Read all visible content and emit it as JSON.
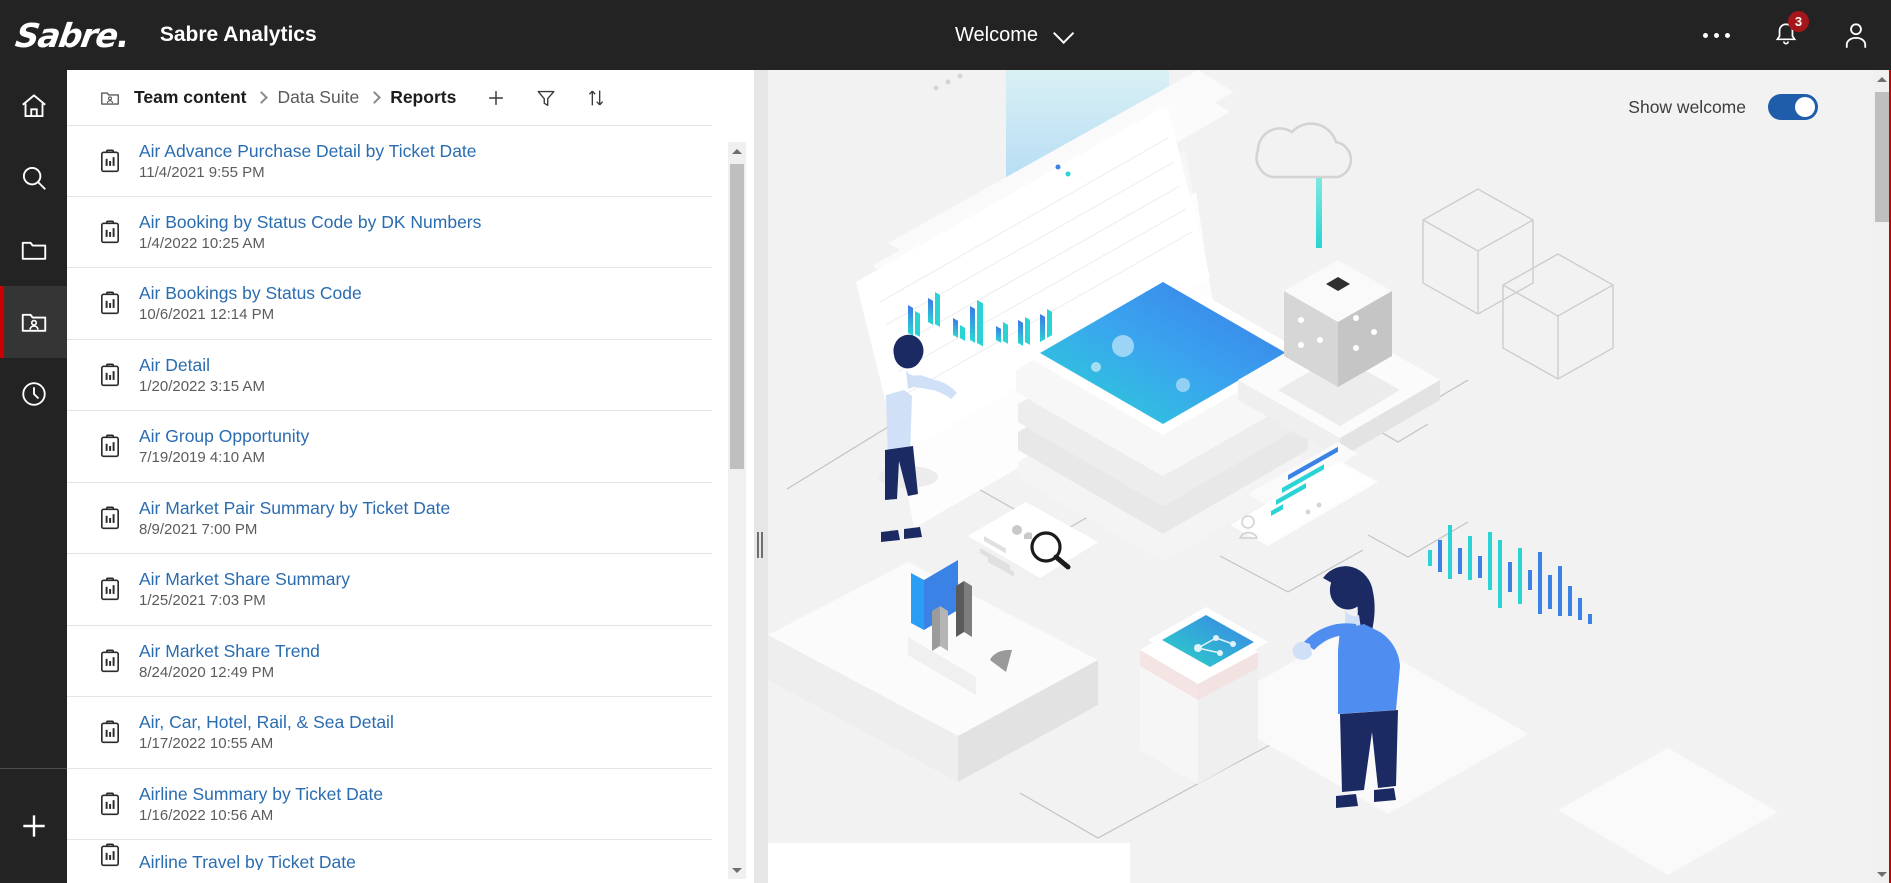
{
  "app": {
    "logo_text": "Sabre",
    "title": "Sabre Analytics",
    "welcome_menu_label": "Welcome"
  },
  "topbar": {
    "overflow_icon": "ellipsis-icon",
    "notifications_icon": "bell-icon",
    "notification_count": "3",
    "account_icon": "user-icon"
  },
  "sidebar": {
    "items": [
      {
        "name": "home",
        "icon": "home-icon",
        "active": false
      },
      {
        "name": "search",
        "icon": "search-icon",
        "active": false
      },
      {
        "name": "my-content",
        "icon": "folder-icon",
        "active": false
      },
      {
        "name": "team-content",
        "icon": "team-folder-icon",
        "active": true
      },
      {
        "name": "recent",
        "icon": "clock-icon",
        "active": false
      }
    ],
    "new_label": "plus-icon"
  },
  "breadcrumb": {
    "icon": "team-folder-icon",
    "items": [
      {
        "label": "Team content",
        "bold": true
      },
      {
        "label": "Data Suite",
        "bold": false
      },
      {
        "label": "Reports",
        "bold": true
      }
    ],
    "actions": [
      {
        "name": "new",
        "icon": "plus-icon"
      },
      {
        "name": "filter",
        "icon": "filter-icon"
      },
      {
        "name": "sort",
        "icon": "sort-icon"
      }
    ]
  },
  "reports": [
    {
      "title": "Air Advance Purchase Detail by Ticket Date",
      "date": "11/4/2021 9:55 PM"
    },
    {
      "title": "Air Booking by Status Code by DK Numbers",
      "date": "1/4/2022 10:25 AM"
    },
    {
      "title": "Air Bookings by Status Code",
      "date": "10/6/2021 12:14 PM"
    },
    {
      "title": "Air Detail",
      "date": "1/20/2022 3:15 AM"
    },
    {
      "title": "Air Group Opportunity",
      "date": "7/19/2019 4:10 AM"
    },
    {
      "title": "Air Market Pair Summary by Ticket Date",
      "date": "8/9/2021 7:00 PM"
    },
    {
      "title": "Air Market Share Summary",
      "date": "1/25/2021 7:03 PM"
    },
    {
      "title": "Air Market Share Trend",
      "date": "8/24/2020 12:49 PM"
    },
    {
      "title": "Air, Car, Hotel, Rail, & Sea Detail",
      "date": "1/17/2022 10:55 AM"
    },
    {
      "title": "Airline Summary by Ticket Date",
      "date": "1/16/2022 10:56 AM"
    },
    {
      "title": "Airline Travel by Ticket Date",
      "date": ""
    }
  ],
  "welcome_panel": {
    "show_welcome_label": "Show welcome",
    "show_welcome_on": true,
    "illustration": "isometric-analytics-illustration"
  },
  "colors": {
    "topbar_bg": "#232323",
    "accent_red": "#cc0000",
    "badge_red": "#a4161a",
    "link_blue": "#2a6cb0",
    "toggle_blue": "#1f5daa",
    "hero_bg": "#f2f2f2",
    "illustration_cyan": "#2ad4d4",
    "illustration_blue": "#3b82e6",
    "figure_navy": "#1b2a63"
  }
}
